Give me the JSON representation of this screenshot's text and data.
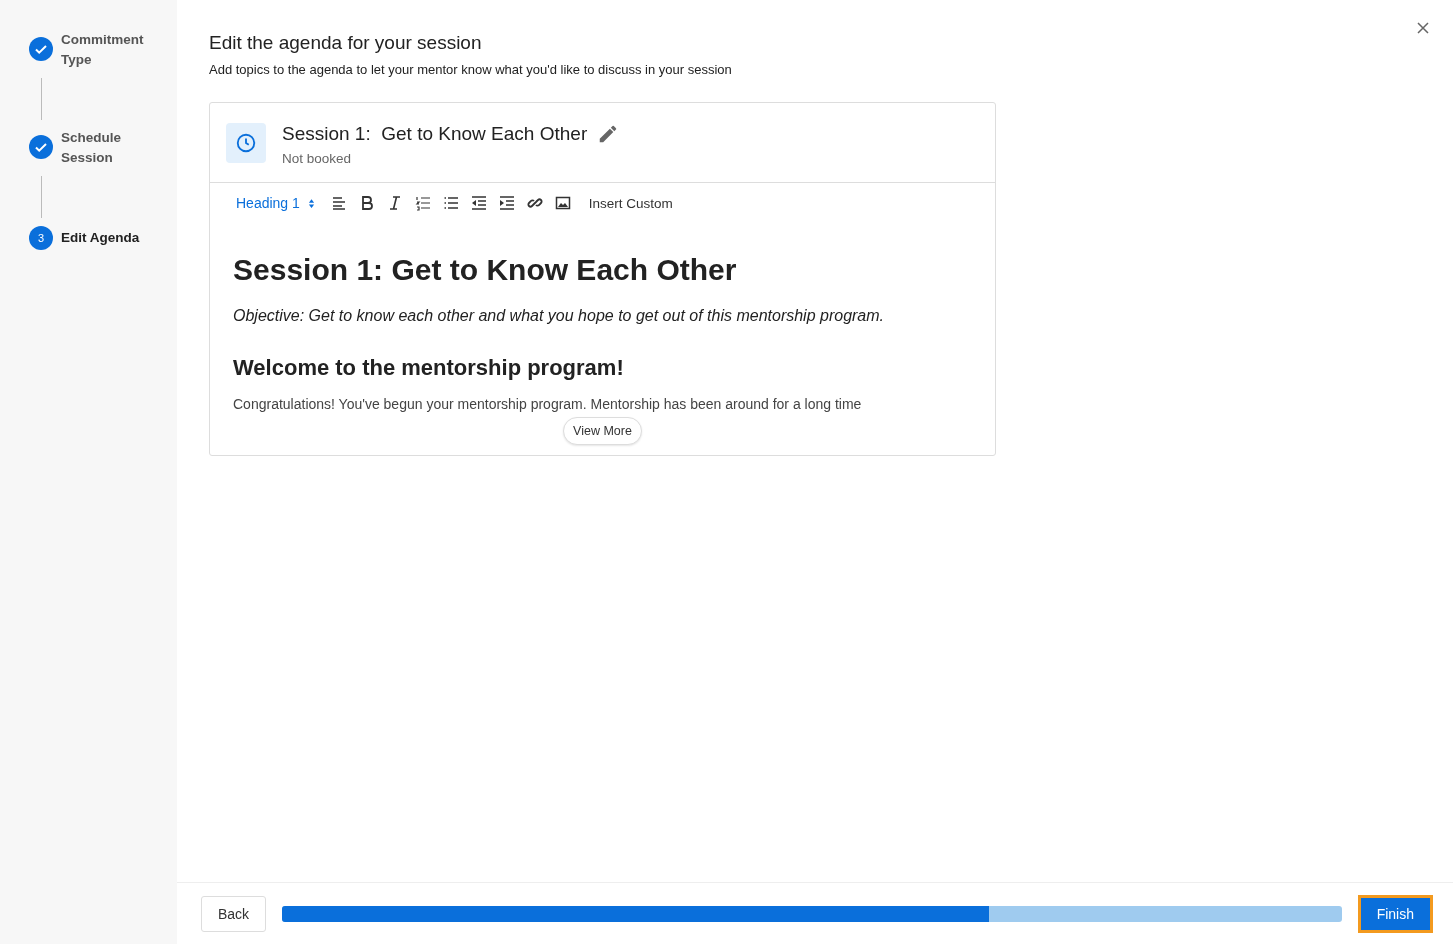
{
  "steps": [
    {
      "label": "Commitment Type",
      "completed": true,
      "current": false
    },
    {
      "label": "Schedule Session",
      "completed": true,
      "current": false
    },
    {
      "number": "3",
      "label": "Edit Agenda",
      "completed": false,
      "current": true
    }
  ],
  "header": {
    "title": "Edit the agenda for your session",
    "subtitle": "Add topics to the agenda to let your mentor know what you'd like to discuss in your session"
  },
  "session": {
    "title": "Session 1:  Get to Know Each Other",
    "status": "Not booked"
  },
  "toolbar": {
    "style_select": "Heading 1",
    "insert_custom": "Insert Custom"
  },
  "editor": {
    "heading": "Session 1: Get to Know Each Other",
    "objective": "Objective: Get to know each other and what you hope to get out of this mentorship program.",
    "subheading": "Welcome to the mentorship program!",
    "paragraph": "Congratulations! You've begun your mentorship program. Mentorship has been around for a long time"
  },
  "view_more": "View More",
  "footer": {
    "back": "Back",
    "progress": {
      "level": 0.667
    },
    "finish": "Finish"
  }
}
